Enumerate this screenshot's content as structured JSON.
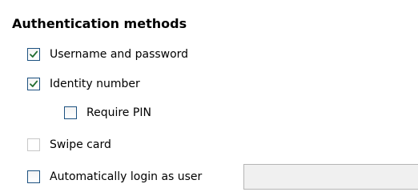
{
  "section": {
    "title": "Authentication methods"
  },
  "options": {
    "username_password": {
      "label": "Username and password",
      "checked": true,
      "enabled": true
    },
    "identity_number": {
      "label": "Identity number",
      "checked": true,
      "enabled": true
    },
    "require_pin": {
      "label": "Require PIN",
      "checked": false,
      "enabled": true
    },
    "swipe_card": {
      "label": "Swipe card",
      "checked": false,
      "enabled": false
    },
    "auto_login": {
      "label": "Automatically login as user",
      "checked": false,
      "enabled": true,
      "user_value": ""
    }
  },
  "colors": {
    "checkbox_border": "#1c5180",
    "checkmark": "#1f6c2f",
    "input_background": "#f0f0f0"
  }
}
